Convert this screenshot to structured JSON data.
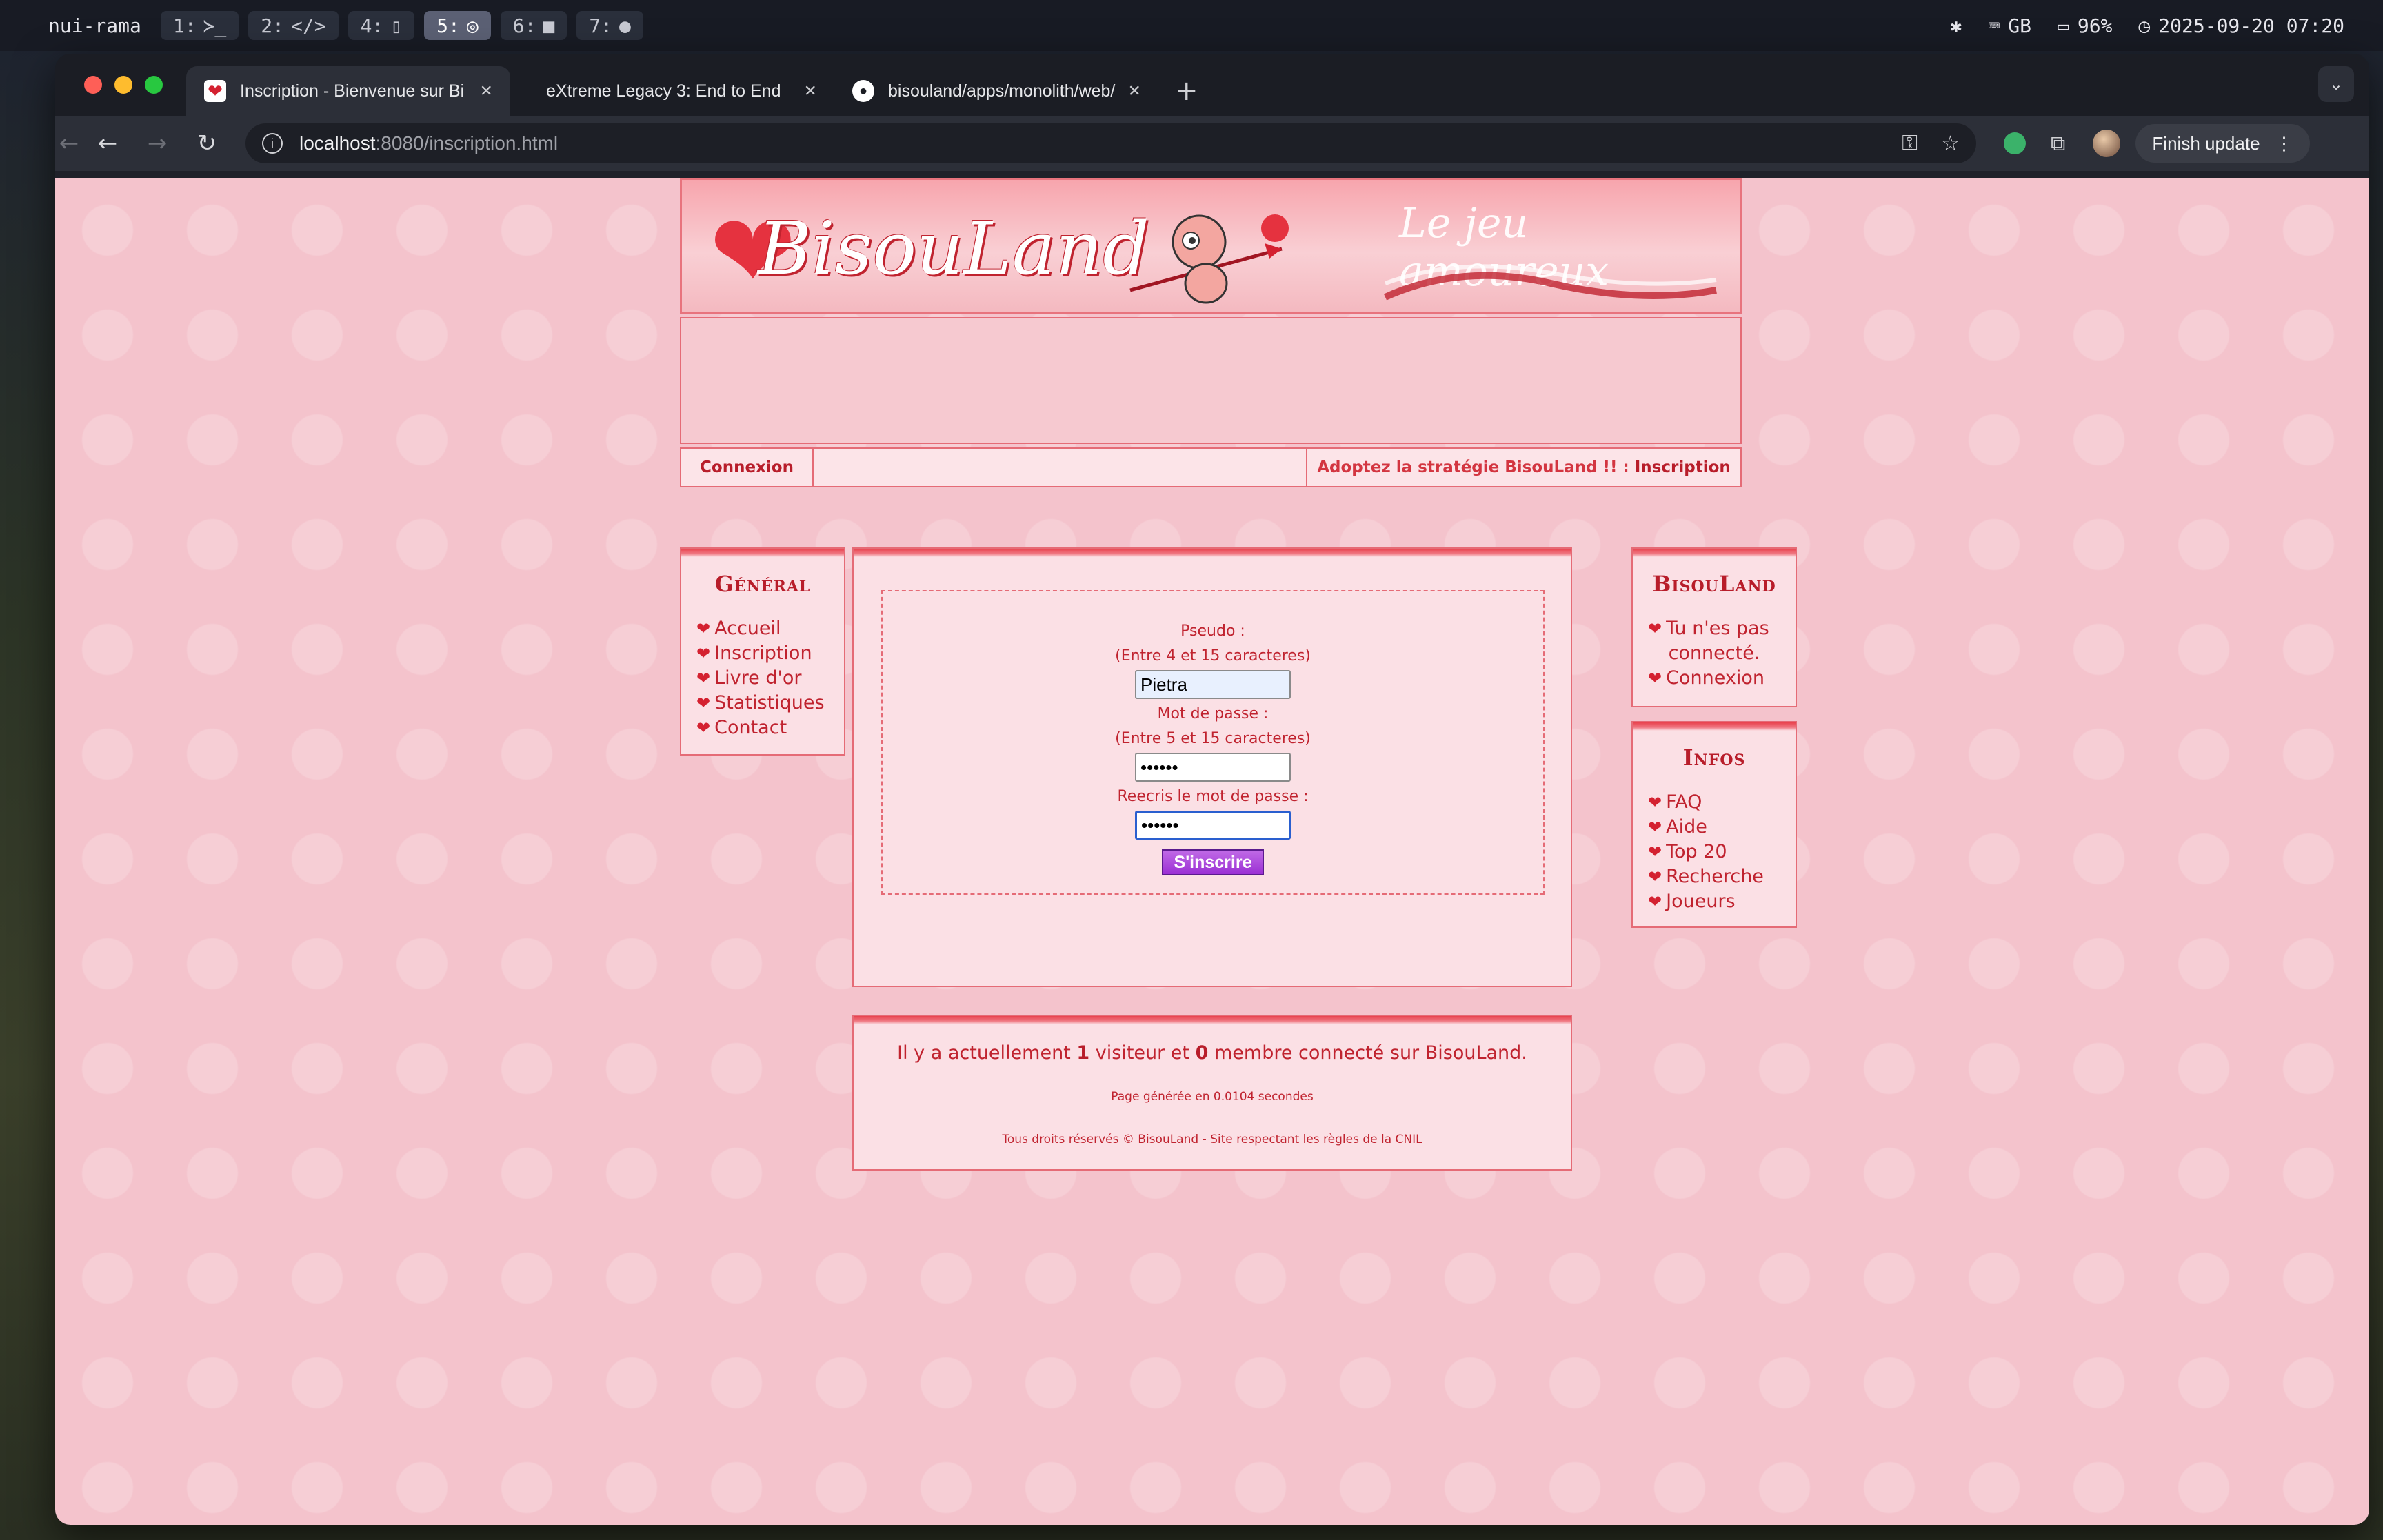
{
  "menubar": {
    "host": "nui-rama",
    "workspaces": [
      {
        "num": "1:",
        "glyph": "≻_"
      },
      {
        "num": "2:",
        "glyph": "</>"
      },
      {
        "num": "4:",
        "glyph": "▯"
      },
      {
        "num": "5:",
        "glyph": "◎"
      },
      {
        "num": "6:",
        "glyph": "■"
      },
      {
        "num": "7:",
        "glyph": "●"
      }
    ],
    "keyboard": "GB",
    "battery": "96%",
    "datetime": "2025-09-20 07:20"
  },
  "browser": {
    "tabs": [
      {
        "title": "Inscription - Bienvenue sur Bi",
        "favicon": "heart-favicon",
        "active": true
      },
      {
        "title": "eXtreme Legacy 3: End to End",
        "favicon": "",
        "active": false
      },
      {
        "title": "bisouland/apps/monolith/web/",
        "favicon": "github-favicon",
        "active": false
      }
    ],
    "url_host": "localhost",
    "url_path": ":8080/inscription.html",
    "finish_update": "Finish update"
  },
  "page": {
    "logo": "BisouLand",
    "slogan": "Le jeu amoureux",
    "navbar": {
      "login": "Connexion",
      "promo": "Adoptez la stratégie BisouLand !! :",
      "promo_link": "Inscription"
    },
    "left_panel": {
      "title": "Général",
      "items": [
        "Accueil",
        "Inscription",
        "Livre d'or",
        "Statistiques",
        "Contact"
      ]
    },
    "right_panel_1": {
      "title": "BisouLand",
      "status_line1": "Tu n'es pas",
      "status_line2": "connecté.",
      "login": "Connexion"
    },
    "right_panel_2": {
      "title": "Infos",
      "items": [
        "FAQ",
        "Aide",
        "Top 20",
        "Recherche",
        "Joueurs"
      ]
    },
    "form": {
      "pseudo_label": "Pseudo :",
      "pseudo_hint": "(Entre 4 et 15 caracteres)",
      "pseudo_value": "Pietra",
      "password_label": "Mot de passe :",
      "password_hint": "(Entre 5 et 15 caracteres)",
      "password_value": "••••••",
      "confirm_label": "Reecris le mot de passe :",
      "confirm_value": "••••••",
      "submit": "S'inscrire"
    },
    "footer": {
      "online_prefix": "Il y a actuellement",
      "visitors": "1",
      "online_mid": "visiteur et",
      "members": "0",
      "online_suffix": "membre connecté sur BisouLand.",
      "generated": "Page générée en 0.0104 secondes",
      "rights": "Tous droits réservés © BisouLand - Site respectant les règles de la CNIL"
    }
  }
}
